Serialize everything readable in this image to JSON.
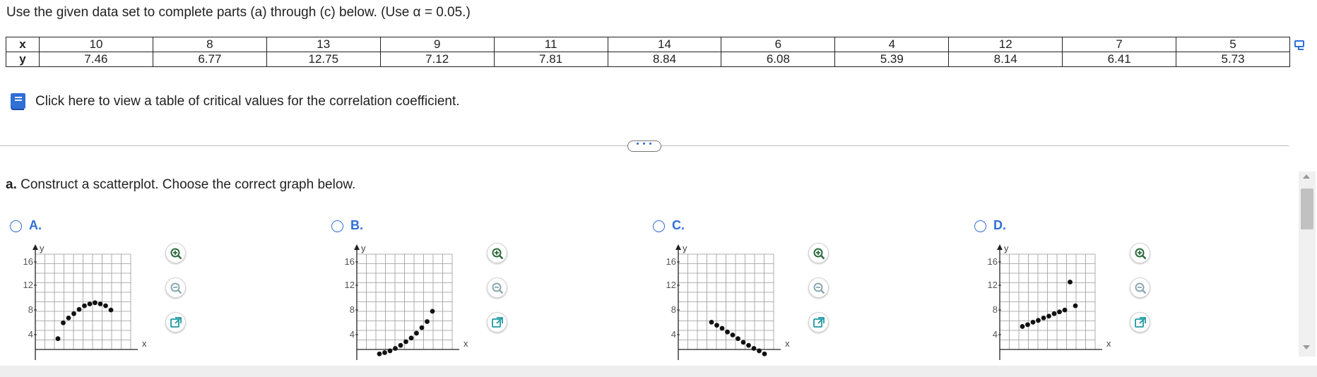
{
  "instruction": "Use the given data set to complete parts (a) through (c) below. (Use α = 0.05.)",
  "data_table": {
    "x_label": "x",
    "y_label": "y",
    "x": [
      "10",
      "8",
      "13",
      "9",
      "11",
      "14",
      "6",
      "4",
      "12",
      "7",
      "5"
    ],
    "y": [
      "7.46",
      "6.77",
      "12.75",
      "7.12",
      "7.81",
      "8.84",
      "6.08",
      "5.39",
      "8.14",
      "6.41",
      "5.73"
    ]
  },
  "critical_link": "Click here to view a table of critical values for the correlation coefficient.",
  "more_button": "• • •",
  "question": {
    "part": "a.",
    "text": " Construct a scatterplot. Choose the correct graph below."
  },
  "options": [
    {
      "label": "A.",
      "points": [
        [
          4,
          3.4
        ],
        [
          5,
          6
        ],
        [
          6,
          6.8
        ],
        [
          7,
          7.5
        ],
        [
          8,
          8.2
        ],
        [
          9,
          8.8
        ],
        [
          10,
          9.1
        ],
        [
          11,
          9.3
        ],
        [
          12,
          9.1
        ],
        [
          13,
          8.8
        ],
        [
          14,
          8.1
        ]
      ]
    },
    {
      "label": "B.",
      "points": [
        [
          4,
          0.9
        ],
        [
          5,
          1.1
        ],
        [
          6,
          1.4
        ],
        [
          7,
          1.8
        ],
        [
          8,
          2.3
        ],
        [
          9,
          2.9
        ],
        [
          10,
          3.5
        ],
        [
          11,
          4.3
        ],
        [
          12,
          5.2
        ],
        [
          13,
          6.2
        ],
        [
          14,
          7.9
        ]
      ]
    },
    {
      "label": "C.",
      "points": [
        [
          6,
          6.1
        ],
        [
          7,
          5.6
        ],
        [
          8,
          5.1
        ],
        [
          9,
          4.5
        ],
        [
          10,
          4
        ],
        [
          11,
          3.4
        ],
        [
          12,
          2.8
        ],
        [
          13,
          2.3
        ],
        [
          14,
          1.8
        ],
        [
          15,
          1.4
        ],
        [
          16,
          0.9
        ]
      ]
    },
    {
      "label": "D.",
      "points": [
        [
          4,
          5.4
        ],
        [
          5,
          5.7
        ],
        [
          6,
          6.1
        ],
        [
          7,
          6.4
        ],
        [
          8,
          6.8
        ],
        [
          9,
          7.1
        ],
        [
          10,
          7.5
        ],
        [
          11,
          7.8
        ],
        [
          12,
          8.1
        ],
        [
          13,
          12.7
        ],
        [
          14,
          8.8
        ]
      ]
    }
  ],
  "axis": {
    "x_label": "x",
    "y_label": "y",
    "y_ticks": [
      "4",
      "8",
      "12",
      "16"
    ]
  },
  "accent_color": "#2f6fd6"
}
